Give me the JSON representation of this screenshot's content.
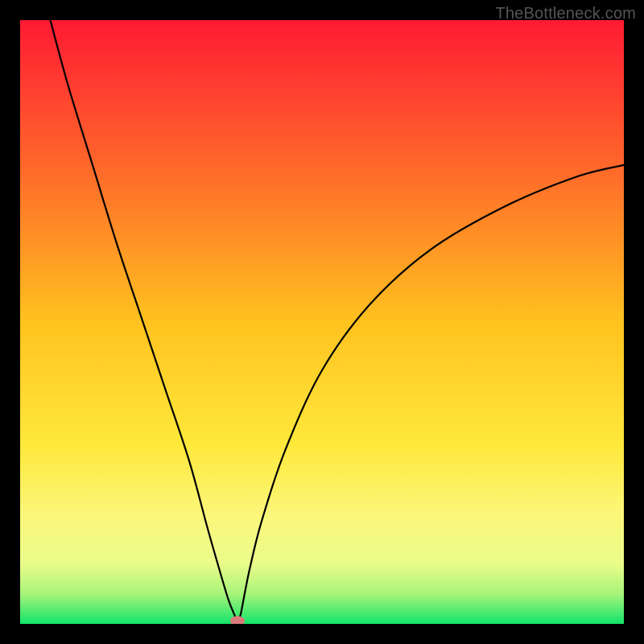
{
  "watermark": "TheBottleneck.com",
  "chart_data": {
    "type": "line",
    "title": "",
    "xlabel": "",
    "ylabel": "",
    "xlim": [
      0,
      100
    ],
    "ylim": [
      0,
      100
    ],
    "grid": false,
    "legend": false,
    "gradient_stops": [
      {
        "offset": 0.0,
        "color": "#ff1a33"
      },
      {
        "offset": 0.25,
        "color": "#ff6a2a"
      },
      {
        "offset": 0.5,
        "color": "#ffc21f"
      },
      {
        "offset": 0.7,
        "color": "#ffe83a"
      },
      {
        "offset": 0.82,
        "color": "#fbf77a"
      },
      {
        "offset": 0.9,
        "color": "#eafc8a"
      },
      {
        "offset": 0.95,
        "color": "#a8f47a"
      },
      {
        "offset": 1.0,
        "color": "#12e46a"
      }
    ],
    "series": [
      {
        "name": "bottleneck-curve",
        "x": [
          5,
          8,
          12,
          16,
          20,
          24,
          28,
          31,
          33,
          34.5,
          35.5,
          36,
          36.5,
          37,
          38,
          40,
          44,
          50,
          58,
          68,
          80,
          92,
          100
        ],
        "y": [
          100,
          89,
          76,
          63,
          51,
          39,
          27,
          16,
          9,
          4,
          1.5,
          0.5,
          1.5,
          4,
          9,
          17,
          29,
          42,
          53,
          62,
          69,
          74,
          76
        ]
      }
    ],
    "minimum_marker": {
      "x": 36,
      "y": 0.5,
      "color": "#d97a7a"
    }
  }
}
